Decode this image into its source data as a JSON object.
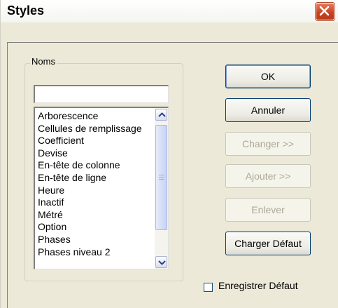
{
  "window": {
    "title": "Styles"
  },
  "names_group": {
    "label": "Noms",
    "input_value": "",
    "items": [
      "Arborescence",
      "Cellules de remplissage",
      "Coefficient",
      "Devise",
      "En-tête de colonne",
      "En-tête de ligne",
      "Heure",
      "Inactif",
      "Métré",
      "Option",
      "Phases",
      "Phases niveau 2"
    ]
  },
  "buttons": {
    "ok": "OK",
    "cancel": "Annuler",
    "change": "Changer >>",
    "add": "Ajouter >>",
    "remove": "Enlever",
    "load_default": "Charger Défaut"
  },
  "save_default": {
    "label": "Enregistrer Défaut",
    "checked": false
  },
  "icons": {
    "close": "close-icon",
    "scroll_up": "scroll-up-arrow-icon",
    "scroll_down": "scroll-down-arrow-icon",
    "grip": "scroll-grip-icon"
  },
  "colors": {
    "dialog_bg": "#ece9d8",
    "close_button": "#c8401f",
    "button_border": "#003c74"
  }
}
